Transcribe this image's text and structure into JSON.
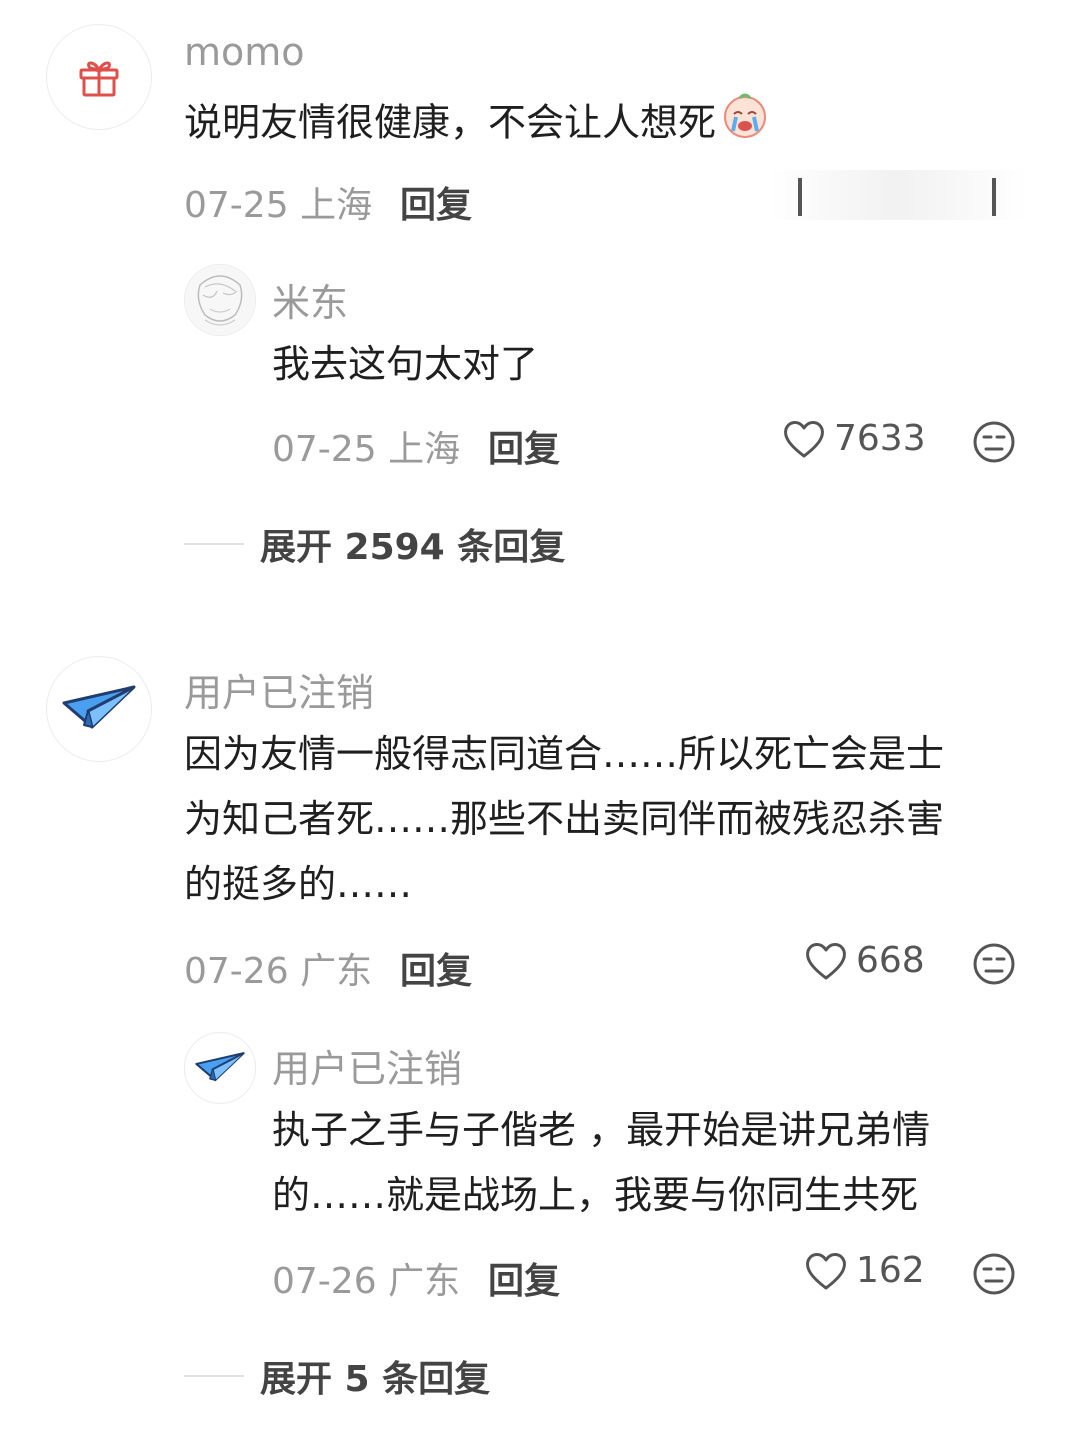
{
  "comments": [
    {
      "username": "momo",
      "avatar_icon": "gift-icon",
      "text": "说明友情很健康，不会让人想死",
      "emoji_icon": "crying-face-icon",
      "date": "07-25",
      "location": "上海",
      "reply_label": "回复",
      "replies": [
        {
          "username": "米东",
          "avatar_icon": "sketch-portrait-avatar",
          "text": "我去这句太对了",
          "date": "07-25",
          "location": "上海",
          "reply_label": "回复",
          "likes": "7633"
        }
      ],
      "expand_label": "展开 2594 条回复"
    },
    {
      "username": "用户已注销",
      "avatar_icon": "paper-plane-icon",
      "text_lines": [
        "因为友情一般得志同道合……所以死亡会是士",
        "为知己者死……那些不出卖同伴而被残忍杀害",
        "的挺多的……"
      ],
      "date": "07-26",
      "location": "广东",
      "reply_label": "回复",
      "likes": "668",
      "replies": [
        {
          "username": "用户已注销",
          "avatar_icon": "paper-plane-icon",
          "text_lines": [
            "执子之手与子偕老 ，最开始是讲兄弟情",
            "的……就是战场上，我要与你同生共死"
          ],
          "date": "07-26",
          "location": "广东",
          "reply_label": "回复",
          "likes": "162"
        }
      ],
      "expand_label": "展开 5 条回复"
    }
  ],
  "colors": {
    "accent_plane": "#3a8ee6",
    "gift_red": "#e0504a",
    "muted_text": "#9a9a9a"
  }
}
